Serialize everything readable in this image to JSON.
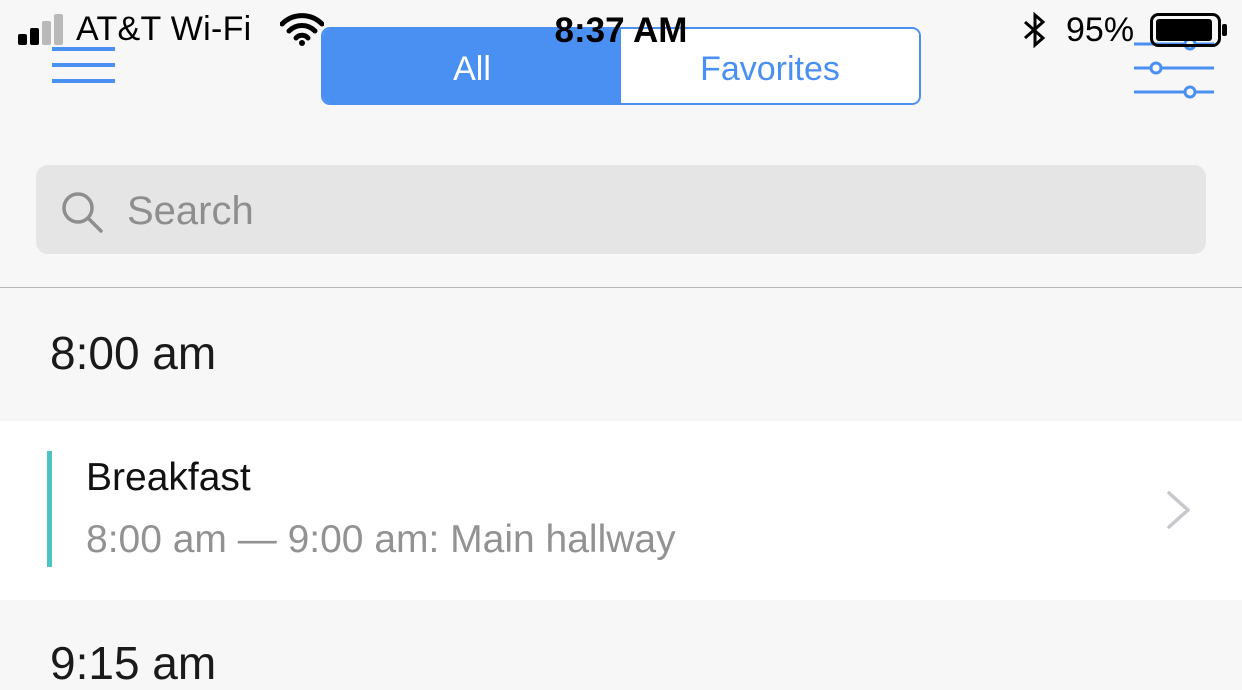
{
  "status_bar": {
    "carrier": "AT&T Wi-Fi",
    "time": "8:37 AM",
    "battery_percent": "95%",
    "signal_bars_filled": 2,
    "signal_bars_total": 4,
    "battery_level": 0.95
  },
  "nav": {
    "menu_icon": "hamburger-menu-icon",
    "filter_icon": "sliders-filter-icon",
    "segments": [
      {
        "label": "All",
        "selected": true
      },
      {
        "label": "Favorites",
        "selected": false
      }
    ]
  },
  "search": {
    "placeholder": "Search",
    "value": "",
    "icon": "magnifier-icon"
  },
  "schedule": {
    "sections": [
      {
        "time_header": "8:00 am",
        "events": [
          {
            "title": "Breakfast",
            "detail": "8:00 am — 9:00 am: Main hallway",
            "accent_color": "#4dc3c3"
          }
        ]
      },
      {
        "time_header": "9:15 am",
        "events": []
      }
    ]
  },
  "colors": {
    "accent_blue": "#4a90f2",
    "background": "#f7f7f7",
    "search_bg": "#e5e5e5",
    "secondary_text": "#929292"
  }
}
